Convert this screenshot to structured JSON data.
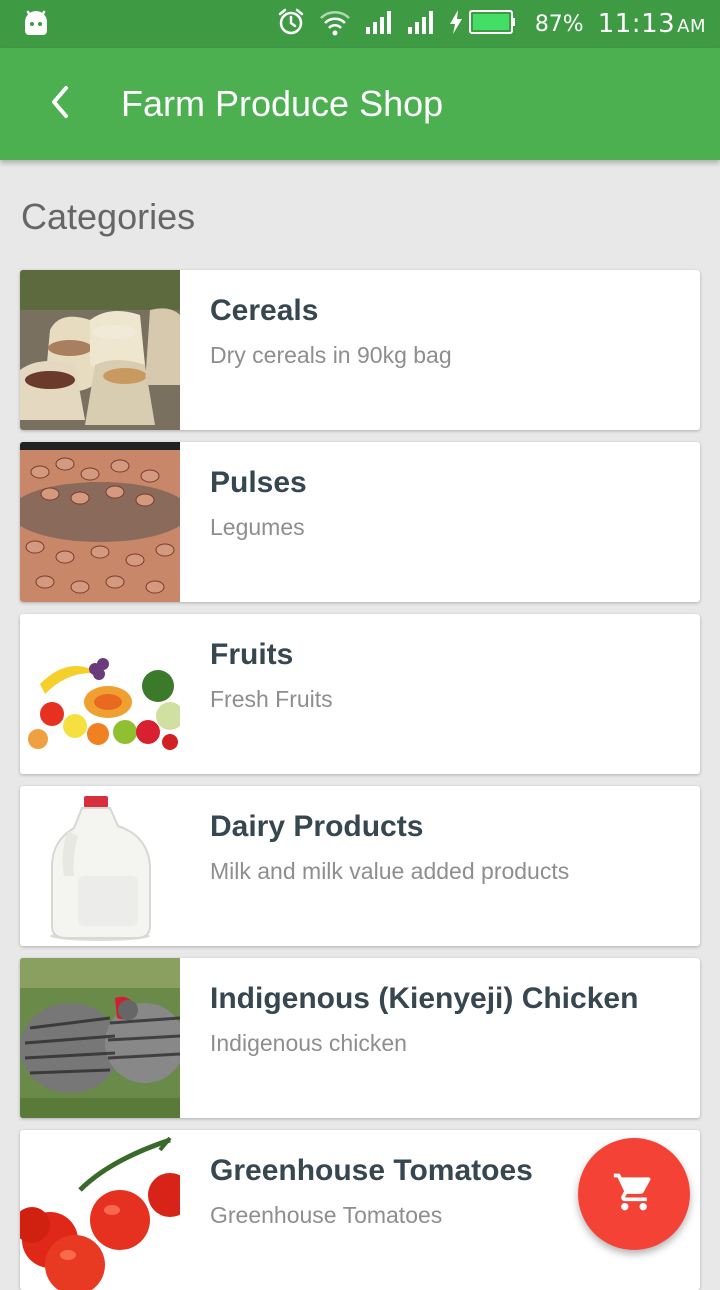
{
  "status_bar": {
    "battery_percent": "87%",
    "time": "11:13",
    "ampm": "AM",
    "icons": [
      "android-icon",
      "alarm-icon",
      "wifi-icon",
      "signal-icon",
      "signal-icon",
      "charging-icon",
      "battery-icon"
    ]
  },
  "app_bar": {
    "title": "Farm Produce Shop",
    "back_icon": "back-arrow-icon"
  },
  "section": {
    "title": "Categories"
  },
  "categories": [
    {
      "name": "Cereals",
      "description": "Dry cereals in 90kg bag",
      "image": "cereal-sacks-image"
    },
    {
      "name": "Pulses",
      "description": "Legumes",
      "image": "beans-bowl-image"
    },
    {
      "name": "Fruits",
      "description": "Fresh Fruits",
      "image": "fruit-assortment-image"
    },
    {
      "name": "Dairy Products",
      "description": "Milk and milk value added products",
      "image": "milk-jug-image"
    },
    {
      "name": "Indigenous (Kienyeji) Chicken",
      "description": "Indigenous chicken",
      "image": "chicken-image"
    },
    {
      "name": "Greenhouse Tomatoes",
      "description": "Greenhouse Tomatoes",
      "image": "tomatoes-image"
    }
  ],
  "fab": {
    "icon": "shopping-cart-icon"
  },
  "colors": {
    "status_bar": "#3f9a44",
    "app_bar": "#4caf50",
    "fab": "#f44336",
    "title_text": "#37474f",
    "description_text": "#8e8e8e"
  }
}
